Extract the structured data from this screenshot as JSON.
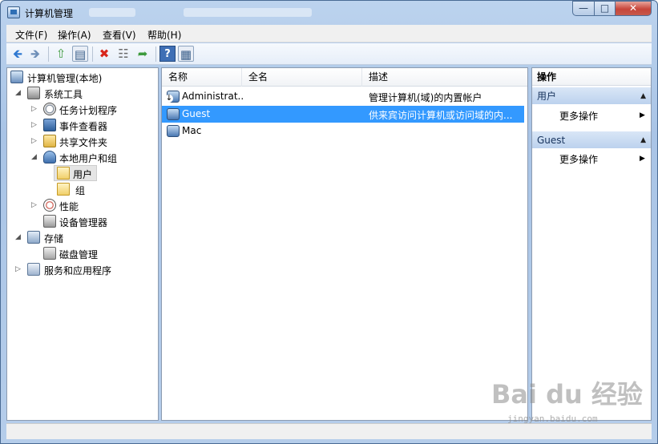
{
  "window": {
    "title": "计算机管理",
    "minimize_glyph": "—",
    "maximize_glyph": "□",
    "close_glyph": "✕"
  },
  "menu": [
    "文件(F)",
    "操作(A)",
    "查看(V)",
    "帮助(H)"
  ],
  "toolbar": {
    "back": "🡸",
    "forward": "🡺",
    "up": "⇧",
    "show_tree": "▤",
    "delete": "✖",
    "properties": "☷",
    "export": "➦",
    "help": "?",
    "action_pane": "▦"
  },
  "tree": {
    "root": "计算机管理(本地)",
    "system_tools": "系统工具",
    "task_scheduler": "任务计划程序",
    "event_viewer": "事件查看器",
    "shared_folders": "共享文件夹",
    "local_users_groups": "本地用户和组",
    "users": "用户",
    "groups": "组",
    "performance": "性能",
    "device_manager": "设备管理器",
    "storage": "存储",
    "disk_management": "磁盘管理",
    "services_apps": "服务和应用程序",
    "expanded_glyph": "◢",
    "collapsed_glyph": "▷"
  },
  "list": {
    "columns": [
      "名称",
      "全名",
      "描述"
    ],
    "rows": [
      {
        "name": "Administrat...",
        "full_name": "",
        "description": "管理计算机(域)的内置帐户"
      },
      {
        "name": "Guest",
        "full_name": "",
        "description": "供来宾访问计算机或访问域的内..."
      },
      {
        "name": "Mac",
        "full_name": "",
        "description": ""
      }
    ]
  },
  "actions": {
    "title": "操作",
    "sections": [
      {
        "header": "用户",
        "item": "更多操作"
      },
      {
        "header": "Guest",
        "item": "更多操作"
      }
    ],
    "caret_glyph": "▲",
    "arrow_glyph": "▶"
  },
  "watermark": {
    "logo": "Bai du 经验",
    "url": "jingyan.baidu.com"
  }
}
